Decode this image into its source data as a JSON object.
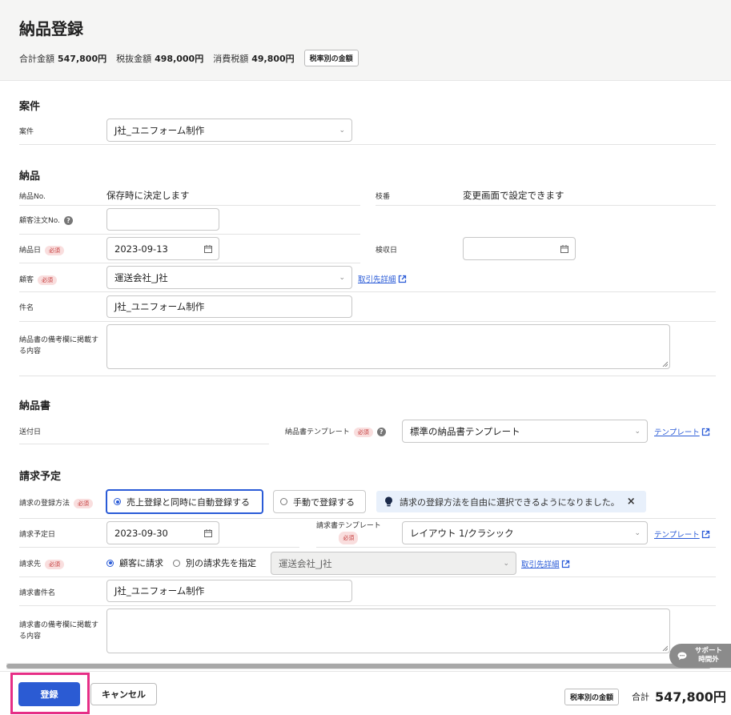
{
  "header": {
    "title": "納品登録",
    "total_label": "合計金額",
    "total_value": "547,800円",
    "pretax_label": "税抜金額",
    "pretax_value": "498,000円",
    "tax_label": "消費税額",
    "tax_value": "49,800円",
    "tax_rate_button": "税率別の金額"
  },
  "project_section": {
    "title": "案件",
    "project_label": "案件",
    "project_value": "J社_ユニフォーム制作"
  },
  "delivery_section": {
    "title": "納品",
    "no_label": "納品No.",
    "no_value": "保存時に決定します",
    "branch_label": "枝番",
    "branch_value": "変更画面で設定できます",
    "order_no_label": "顧客注文No.",
    "order_no_value": "",
    "date_label": "納品日",
    "date_value": "2023-09-13",
    "inspection_label": "検収日",
    "inspection_value": "",
    "customer_label": "顧客",
    "customer_value": "運送会社_J社",
    "customer_link": "取引先詳細",
    "subject_label": "件名",
    "subject_value": "J社_ユニフォーム制作",
    "remarks_label": "納品書の備考欄に掲載する内容",
    "remarks_value": ""
  },
  "document_section": {
    "title": "納品書",
    "send_date_label": "送付日",
    "template_label": "納品書テンプレート",
    "template_value": "標準の納品書テンプレート",
    "template_link": "テンプレート"
  },
  "billing_section": {
    "title": "請求予定",
    "method_label": "請求の登録方法",
    "method_auto": "売上登録と同時に自動登録する",
    "method_manual": "手動で登録する",
    "info_text": "請求の登録方法を自由に選択できるようになりました。",
    "close_icon": "×",
    "date_label": "請求予定日",
    "date_value": "2023-09-30",
    "template_label": "請求書テンプレート",
    "template_value": "レイアウト 1/クラシック",
    "template_link": "テンプレート",
    "billto_label": "請求先",
    "billto_option_customer": "顧客に請求",
    "billto_option_other": "別の請求先を指定",
    "billto_value": "運送会社_J社",
    "billto_link": "取引先詳細",
    "invoice_subject_label": "請求書件名",
    "invoice_subject_value": "J社_ユニフォーム制作",
    "invoice_remarks_label": "請求書の備考欄に掲載する内容",
    "invoice_remarks_value": ""
  },
  "common": {
    "required": "必須",
    "help": "?"
  },
  "support": {
    "line1": "サポート",
    "line2": "時間外"
  },
  "footer": {
    "register_button": "登録",
    "cancel_button": "キャンセル",
    "tax_rate_button": "税率別の金額",
    "total_label": "合計",
    "total_value": "547,800円"
  }
}
